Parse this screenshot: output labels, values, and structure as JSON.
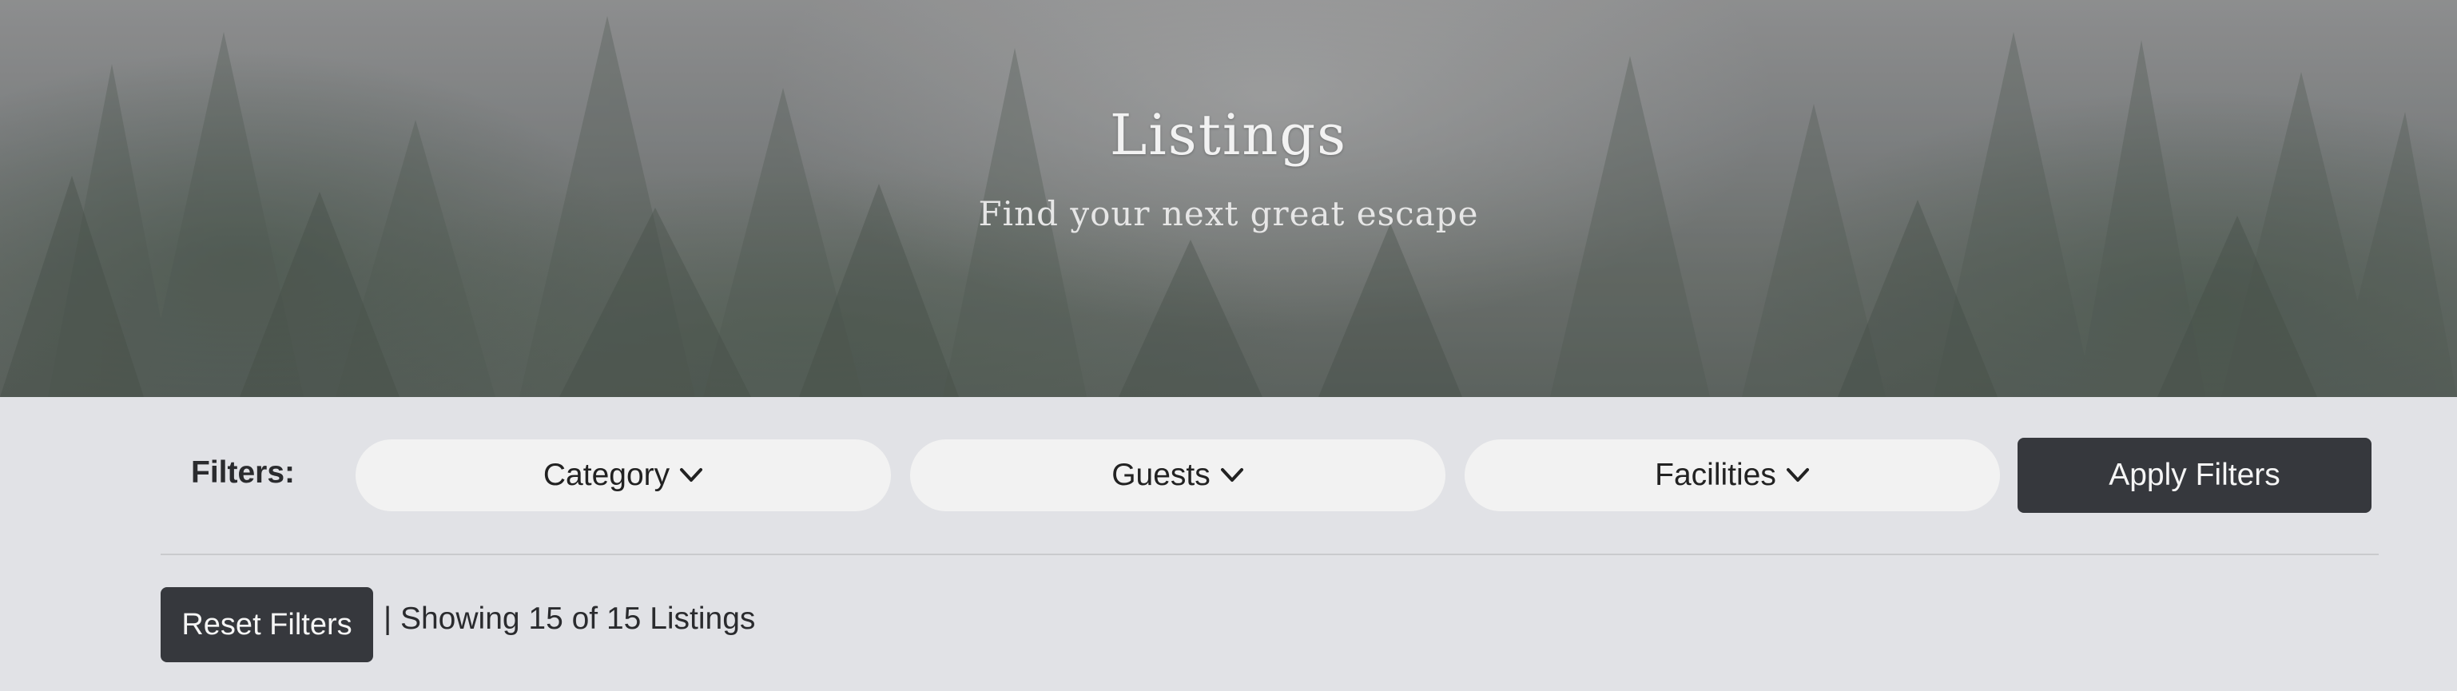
{
  "hero": {
    "title": "Listings",
    "subtitle": "Find your next great escape"
  },
  "filters": {
    "label": "Filters:",
    "dropdowns": [
      {
        "label": "Category",
        "icon": "chevron-down-icon"
      },
      {
        "label": "Guests",
        "icon": "chevron-down-icon"
      },
      {
        "label": "Facilities",
        "icon": "chevron-down-icon"
      }
    ],
    "apply_label": "Apply Filters"
  },
  "results_bar": {
    "reset_label": "Reset Filters",
    "summary": "| Showing 15 of 15 Listings"
  },
  "colors": {
    "page_bg": "#e1e2e6",
    "pill_bg": "#f2f2f2",
    "button_bg": "#36383d",
    "button_text": "#f5f5f5"
  }
}
